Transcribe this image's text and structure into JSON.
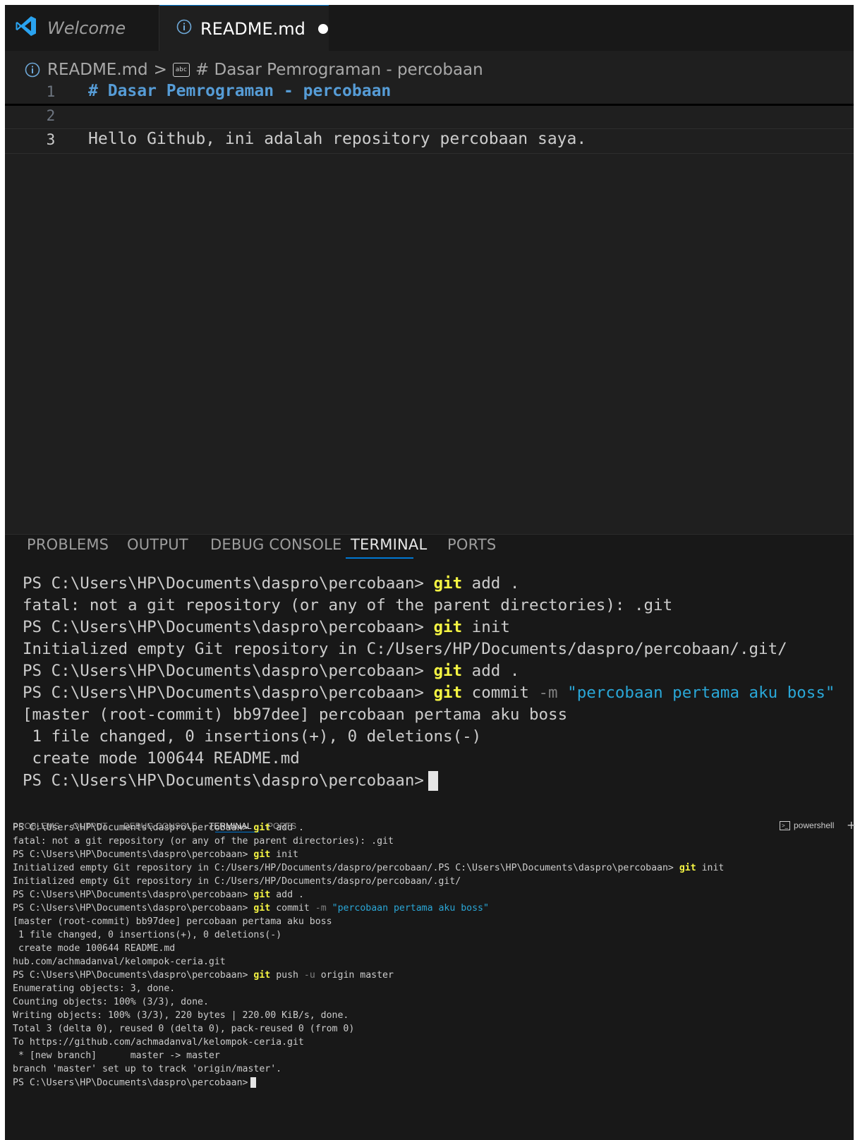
{
  "editor": {
    "tabs": [
      {
        "label": "Welcome",
        "icon": "vscode-logo-icon"
      },
      {
        "label": "README.md",
        "icon": "info-icon",
        "unsaved": true
      }
    ],
    "breadcrumb": {
      "file": "README.md",
      "separator": ">",
      "symbol": "# Dasar Pemrograman - percobaan",
      "symbol_icon_text": "abc"
    },
    "lines": [
      {
        "number": "1",
        "text": "# Dasar Pemrograman - percobaan"
      },
      {
        "number": "2",
        "text": ""
      },
      {
        "number": "3",
        "text": "Hello Github, ini adalah repository percobaan saya."
      }
    ]
  },
  "panel": {
    "tabs": [
      "PROBLEMS",
      "OUTPUT",
      "DEBUG CONSOLE",
      "TERMINAL",
      "PORTS"
    ],
    "active_tab": "TERMINAL",
    "shell_label": "powershell",
    "plus": "+"
  },
  "terminal_top": {
    "prompt": "PS C:\\Users\\HP\\Documents\\daspro\\percobaan>",
    "git": "git",
    "cmd_add_args": " add .",
    "cmd_init_args": " init",
    "cmd_commit_args": " commit ",
    "cmd_commit_flag": "-m",
    "cmd_commit_msg": "\"percobaan pertama aku boss\"",
    "out_fatal": "fatal: not a git repository (or any of the parent directories): .git",
    "out_init": "Initialized empty Git repository in C:/Users/HP/Documents/daspro/percobaan/.git/",
    "out_commit1": "[master (root-commit) bb97dee] percobaan pertama aku boss",
    "out_commit2": " 1 file changed, 0 insertions(+), 0 deletions(-)",
    "out_commit3": " create mode 100644 README.md"
  },
  "terminal_bottom": {
    "out_init_partial": "Initialized empty Git repository in C:/Users/HP/Documents/daspro/percobaan/.",
    "out_hub": "hub.com/achmadanval/kelompok-ceria.git",
    "cmd_push_args": " push ",
    "cmd_push_flag": "-u",
    "cmd_push_rest": " origin master",
    "push_out": [
      "Enumerating objects: 3, done.",
      "Counting objects: 100% (3/3), done.",
      "Writing objects: 100% (3/3), 220 bytes | 220.00 KiB/s, done.",
      "Total 3 (delta 0), reused 0 (delta 0), pack-reused 0 (from 0)",
      "To https://github.com/achmadanval/kelompok-ceria.git",
      " * [new branch]      master -> master",
      "branch 'master' set up to track 'origin/master'."
    ]
  },
  "colors": {
    "git_keyword": "#f5f543",
    "string": "#2aa7d7",
    "heading": "#569cd6",
    "accent": "#0078d4"
  }
}
